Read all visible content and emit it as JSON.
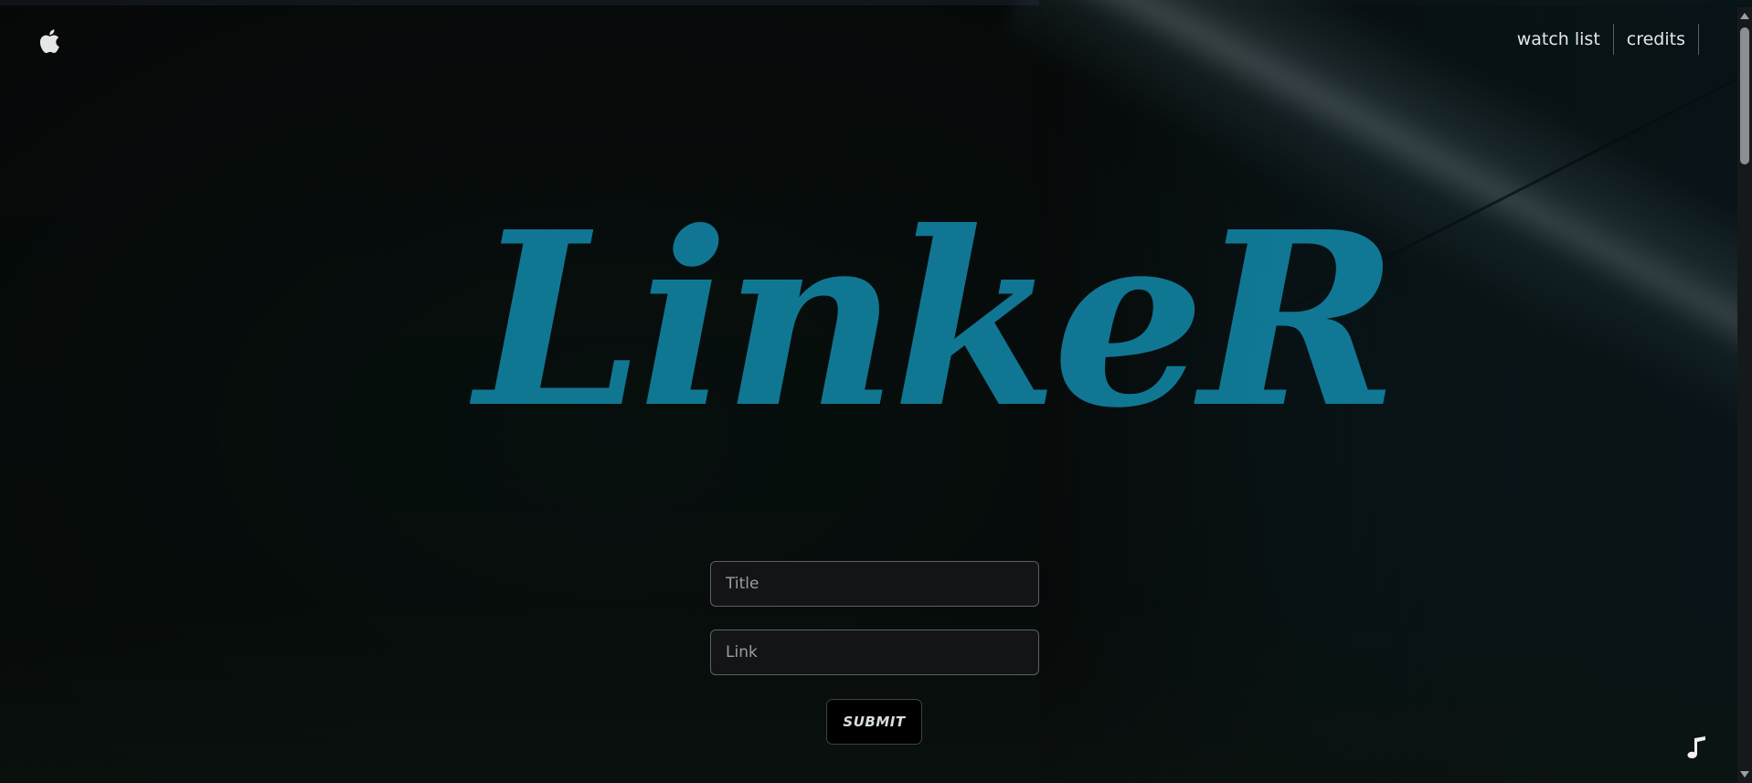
{
  "header": {
    "logo_icon": "apple-icon",
    "nav": [
      {
        "label": "watch list"
      },
      {
        "label": "credits"
      }
    ]
  },
  "hero": {
    "brand": "LinkeR"
  },
  "form": {
    "title_placeholder": "Title",
    "link_placeholder": "Link",
    "submit_label": "SUBMIT"
  },
  "footer": {
    "music_icon": "music-note-icon"
  },
  "colors": {
    "brand": "#11809f",
    "background": "#0a0f0e",
    "input_bg": "#121416"
  }
}
